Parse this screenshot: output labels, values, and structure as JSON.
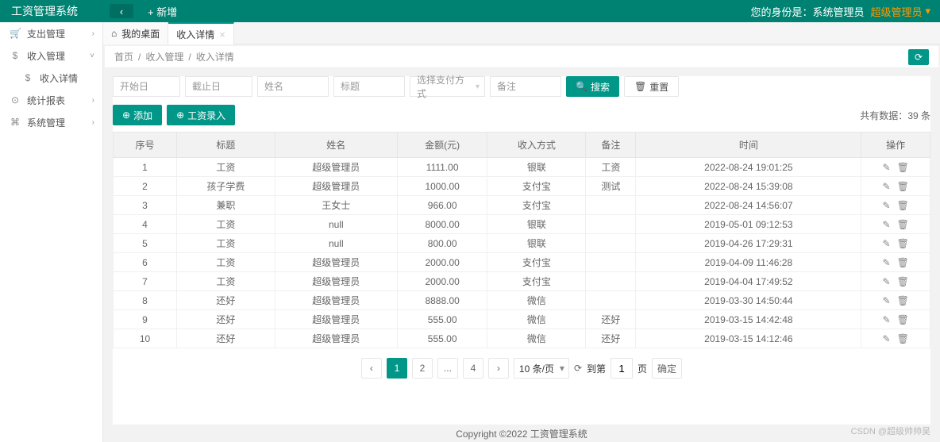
{
  "header": {
    "title": "工资管理系统",
    "add_label": "+ 新增",
    "identity_label": "您的身份是：系统管理员",
    "role": "超级管理员"
  },
  "sidebar": {
    "items": [
      {
        "icon": "🛒",
        "label": "支出管理",
        "arrow": "›"
      },
      {
        "icon": "$",
        "label": "收入管理",
        "arrow": "˅"
      },
      {
        "icon": "$",
        "label": "收入详情",
        "sub": true
      },
      {
        "icon": "⊙",
        "label": "统计报表",
        "arrow": "›"
      },
      {
        "icon": "⌘",
        "label": "系统管理",
        "arrow": "›"
      }
    ]
  },
  "tabs": [
    {
      "icon": "⌂",
      "label": "我的桌面",
      "closable": false
    },
    {
      "label": "收入详情",
      "closable": true,
      "active": true
    }
  ],
  "breadcrumb": [
    "首页",
    "收入管理",
    "收入详情"
  ],
  "search": {
    "start_date": "开始日",
    "end_date": "截止日",
    "name": "姓名",
    "title": "标题",
    "pay_method": "选择支付方式",
    "remark": "备注",
    "search_btn": "搜索",
    "reset_btn": "重置"
  },
  "toolbar": {
    "add_label": "添加",
    "salary_label": "工资录入",
    "total_label": "共有数据：",
    "total_count": "39 条"
  },
  "table": {
    "columns": [
      "序号",
      "标题",
      "姓名",
      "金额(元)",
      "收入方式",
      "备注",
      "时间",
      "操作"
    ],
    "rows": [
      [
        "1",
        "工资",
        "超级管理员",
        "1111.00",
        "银联",
        "工资",
        "2022-08-24 19:01:25"
      ],
      [
        "2",
        "孩子学费",
        "超级管理员",
        "1000.00",
        "支付宝",
        "测试",
        "2022-08-24 15:39:08"
      ],
      [
        "3",
        "兼职",
        "王女士",
        "966.00",
        "支付宝",
        "",
        "2022-08-24 14:56:07"
      ],
      [
        "4",
        "工资",
        "null",
        "8000.00",
        "银联",
        "",
        "2019-05-01 09:12:53"
      ],
      [
        "5",
        "工资",
        "null",
        "800.00",
        "银联",
        "",
        "2019-04-26 17:29:31"
      ],
      [
        "6",
        "工资",
        "超级管理员",
        "2000.00",
        "支付宝",
        "",
        "2019-04-09 11:46:28"
      ],
      [
        "7",
        "工资",
        "超级管理员",
        "2000.00",
        "支付宝",
        "",
        "2019-04-04 17:49:52"
      ],
      [
        "8",
        "还好",
        "超级管理员",
        "8888.00",
        "微信",
        "",
        "2019-03-30 14:50:44"
      ],
      [
        "9",
        "还好",
        "超级管理员",
        "555.00",
        "微信",
        "还好",
        "2019-03-15 14:42:48"
      ],
      [
        "10",
        "还好",
        "超级管理员",
        "555.00",
        "微信",
        "还好",
        "2019-03-15 14:12:46"
      ]
    ]
  },
  "pagination": {
    "prev": "‹",
    "pages": [
      "1",
      "2",
      "...",
      "4"
    ],
    "next": "›",
    "per_page": "10 条/页",
    "goto_label": "到第",
    "goto_value": "1",
    "page_label": "页",
    "confirm": "确定"
  },
  "footer": "Copyright ©2022 工资管理系统",
  "watermark": "CSDN @超级帅帅吴"
}
